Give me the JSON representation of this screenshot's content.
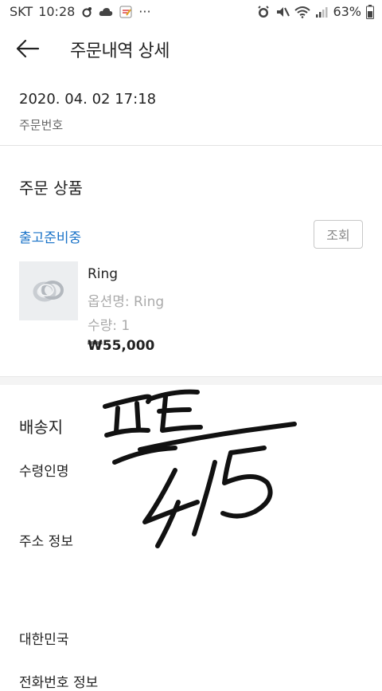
{
  "status_bar": {
    "carrier": "SKT",
    "time": "10:28",
    "more": "···",
    "battery": "63%"
  },
  "header": {
    "title": "주문내역 상세"
  },
  "order": {
    "date": "2020. 04. 02 17:18",
    "number_label": "주문번호"
  },
  "products_section": {
    "title": "주문 상품",
    "status": "출고준비중",
    "inquiry_button": "조회",
    "item": {
      "name": "Ring",
      "option": "옵션명: Ring",
      "quantity": "수량: 1",
      "price": "₩55,000"
    }
  },
  "shipping_section": {
    "title": "배송지",
    "recipient_label": "수령인명",
    "address_label": "주소 정보",
    "country": "대한민국",
    "phone_label": "전화번호 정보"
  },
  "handwriting_text": "프트 4/5",
  "colors": {
    "accent_blue": "#1a73c8",
    "muted_gray": "#aaaaaa",
    "divider": "#e3e3e3"
  }
}
